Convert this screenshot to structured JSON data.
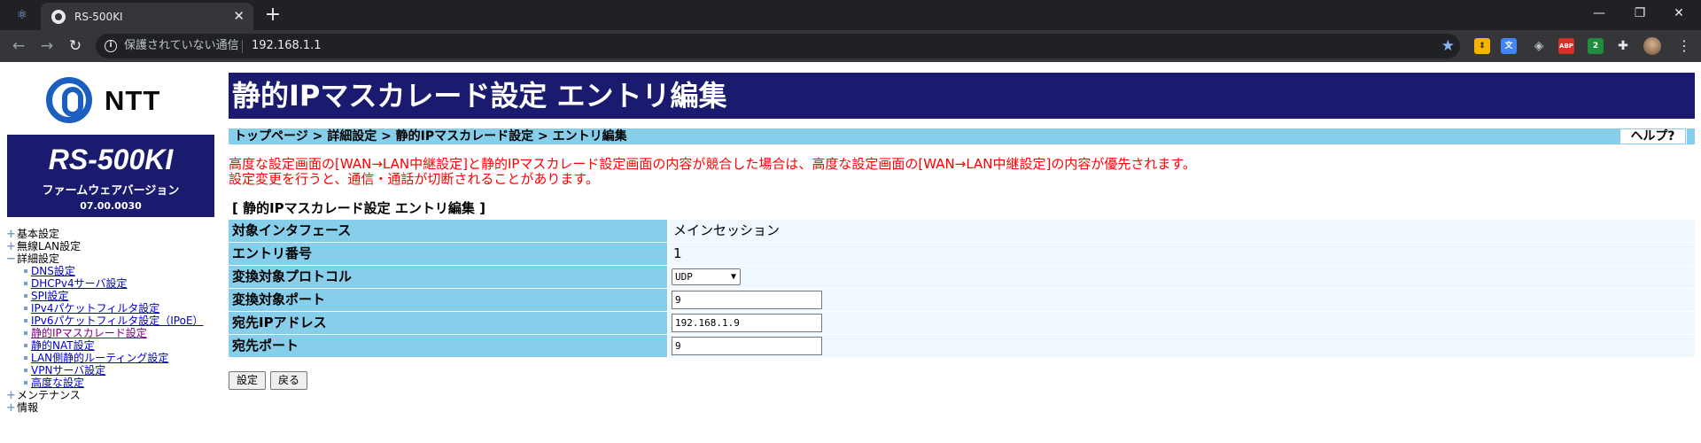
{
  "browser": {
    "tab_title": "RS-500KI",
    "security_text": "保護されていない通信",
    "url": "192.168.1.1",
    "window_controls": [
      "minimize-icon",
      "restore-icon",
      "close-icon"
    ],
    "extensions": [
      {
        "name": "arrows-extension-icon",
        "color": "#f4b400",
        "text": "⇕"
      },
      {
        "name": "translate-extension-icon",
        "color": "#4285f4",
        "text": "文"
      },
      {
        "name": "target-extension-icon",
        "color": "#5f6368",
        "text": "◈"
      },
      {
        "name": "adblock-plus-icon",
        "color": "#d93025",
        "text": "ABP"
      },
      {
        "name": "badge-extension-icon",
        "color": "#1e8e3e",
        "text": "2"
      },
      {
        "name": "puzzle-extensions-icon",
        "color": "#35363a",
        "text": "✚"
      }
    ]
  },
  "sidebar": {
    "logo_text": "NTT",
    "model_name": "RS-500KI",
    "fw_label": "ファームウェアバージョン",
    "fw_version": "07.00.0030",
    "nav": [
      {
        "label": "基本設定",
        "marker": "+"
      },
      {
        "label": "無線LAN設定",
        "marker": "+"
      },
      {
        "label": "詳細設定",
        "marker": "−"
      }
    ],
    "sub_links": [
      {
        "label": "DNS設定",
        "visited": false
      },
      {
        "label": "DHCPv4サーバ設定",
        "visited": false
      },
      {
        "label": "SPI設定",
        "visited": false
      },
      {
        "label": "IPv4パケットフィルタ設定",
        "visited": false
      },
      {
        "label": "IPv6パケットフィルタ設定（IPoE）",
        "visited": false
      },
      {
        "label": "静的IPマスカレード設定",
        "visited": true
      },
      {
        "label": "静的NAT設定",
        "visited": false
      },
      {
        "label": "LAN側静的ルーティング設定",
        "visited": false
      },
      {
        "label": "VPNサーバ設定",
        "visited": false
      },
      {
        "label": "高度な設定",
        "visited": false
      }
    ],
    "nav_bottom": [
      {
        "label": "メンテナンス",
        "marker": "+"
      },
      {
        "label": "情報",
        "marker": "+"
      }
    ]
  },
  "main": {
    "title": "静的IPマスカレード設定 エントリ編集",
    "breadcrumb": "トップページ > 詳細設定 > 静的IPマスカレード設定 > エントリ編集",
    "help_label": "ヘルプ?",
    "warning_line1": "高度な設定画面の[WAN→LAN中継設定]と静的IPマスカレード設定画面の内容が競合した場合は、高度な設定画面の[WAN→LAN中継設定]の内容が優先されます。",
    "warning_line2": "設定変更を行うと、通信・通話が切断されることがあります。",
    "form_title": "[ 静的IPマスカレード設定 エントリ編集 ]",
    "rows": {
      "interface": {
        "label": "対象インタフェース",
        "value": "メインセッション"
      },
      "entry_no": {
        "label": "エントリ番号",
        "value": "1"
      },
      "protocol": {
        "label": "変換対象プロトコル",
        "value": "UDP"
      },
      "port": {
        "label": "変換対象ポート",
        "value": "9"
      },
      "dest_ip": {
        "label": "宛先IPアドレス",
        "value": "192.168.1.9"
      },
      "dest_port": {
        "label": "宛先ポート",
        "value": "9"
      }
    },
    "buttons": {
      "submit": "設定",
      "back": "戻る"
    }
  }
}
